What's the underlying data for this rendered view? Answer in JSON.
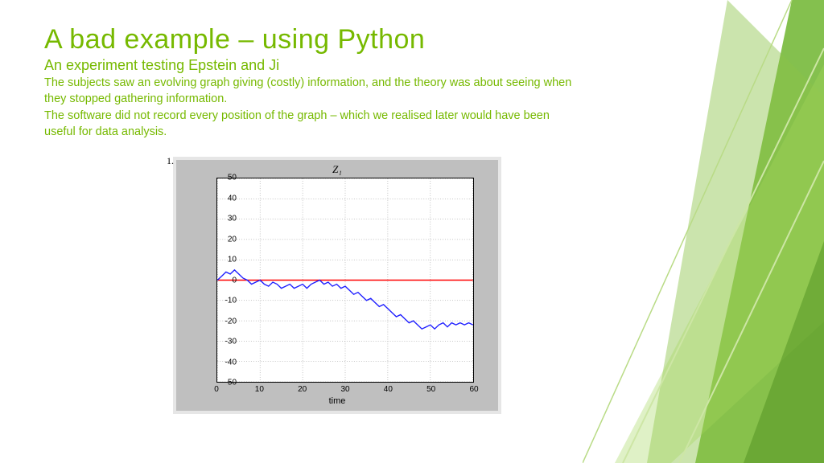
{
  "title": "A bad example – using Python",
  "subtitle": "An experiment testing Epstein and Ji",
  "body_line1": "The subjects saw an evolving graph giving (costly) information, and the theory was about seeing when they stopped gathering information.",
  "body_line2": "The software did not record every position of the graph – which we realised later would  have been useful for data analysis.",
  "one_label": "1.",
  "chart_data": {
    "type": "line",
    "title": "Z₁",
    "xlabel": "time",
    "ylabel": "",
    "xlim": [
      0,
      60
    ],
    "ylim": [
      -50,
      50
    ],
    "xticks": [
      0,
      10,
      20,
      30,
      40,
      50,
      60
    ],
    "yticks": [
      -50,
      -40,
      -30,
      -20,
      -10,
      0,
      10,
      20,
      30,
      40,
      50
    ],
    "series": [
      {
        "name": "zero-line",
        "color": "#ff0000",
        "x": [
          0,
          60
        ],
        "y": [
          0,
          0
        ]
      },
      {
        "name": "Z1",
        "color": "#1f1fff",
        "x": [
          0,
          1,
          2,
          3,
          4,
          5,
          6,
          7,
          8,
          9,
          10,
          11,
          12,
          13,
          14,
          15,
          16,
          17,
          18,
          19,
          20,
          21,
          22,
          23,
          24,
          25,
          26,
          27,
          28,
          29,
          30,
          31,
          32,
          33,
          34,
          35,
          36,
          37,
          38,
          39,
          40,
          41,
          42,
          43,
          44,
          45,
          46,
          47,
          48,
          49,
          50,
          51,
          52,
          53,
          54,
          55,
          56,
          57,
          58,
          59,
          60
        ],
        "y": [
          0,
          2,
          4,
          3,
          5,
          3,
          1,
          0,
          -2,
          -1,
          0,
          -2,
          -3,
          -1,
          -2,
          -4,
          -3,
          -2,
          -4,
          -3,
          -2,
          -4,
          -2,
          -1,
          0,
          -2,
          -1,
          -3,
          -2,
          -4,
          -3,
          -5,
          -7,
          -6,
          -8,
          -10,
          -9,
          -11,
          -13,
          -12,
          -14,
          -16,
          -18,
          -17,
          -19,
          -21,
          -20,
          -22,
          -24,
          -23,
          -22,
          -24,
          -22,
          -21,
          -23,
          -21,
          -22,
          -21,
          -22,
          -21,
          -22
        ]
      }
    ]
  }
}
